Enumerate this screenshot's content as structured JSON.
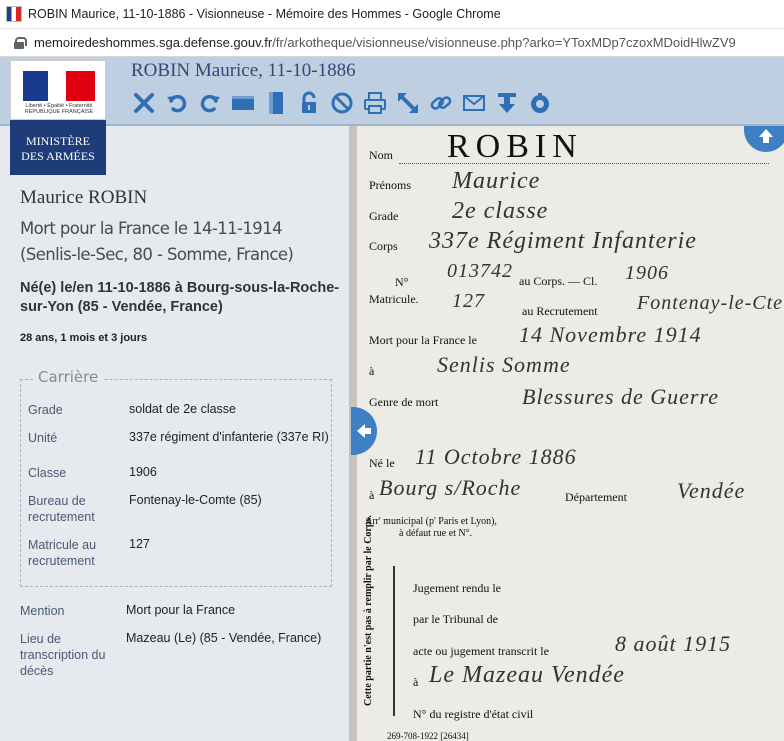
{
  "browser": {
    "window_title": "ROBIN Maurice, 11-10-1886 - Visionneuse - Mémoire des Hommes - Google Chrome",
    "url_host": "memoiredeshommes.sga.defense.gouv.fr",
    "url_path": "/fr/arkotheque/visionneuse/visionneuse.php?arko=YToxMDp7czoxMDoidHlwZV9"
  },
  "header": {
    "doc_title": "ROBIN Maurice, 11-10-1886",
    "ministry_line1": "MINISTÈRE",
    "ministry_line2": "DES ARMÉES",
    "logo_text": "Liberté • Égalité • Fraternité RÉPUBLIQUE FRANÇAISE",
    "accent": "#2f6fb3",
    "toolbar_icons": [
      "close-icon",
      "undo-icon",
      "redo-icon",
      "horizontal-fit-icon",
      "vertical-fit-icon",
      "lock-icon",
      "no-entry-icon",
      "print-icon",
      "expand-icon",
      "link-icon",
      "mail-icon",
      "download-icon",
      "lifebuoy-icon"
    ]
  },
  "record": {
    "name": "Maurice ROBIN",
    "death": "Mort pour la France le 14-11-1914 (Senlis-le-Sec, 80 - Somme, France)",
    "birth": "Né(e) le/en 11-10-1886 à Bourg-sous-la-Roche-sur-Yon (85 - Vendée, France)",
    "age": "28 ans, 1 mois et 3 jours",
    "career_legend": "Carrière",
    "career": [
      {
        "label": "Grade",
        "value": "soldat de 2e classe"
      },
      {
        "label": "Unité",
        "value": "337e régiment d'infanterie (337e RI)"
      },
      {
        "label": "Classe",
        "value": "1906"
      },
      {
        "label": "Bureau de recrutement",
        "value": "Fontenay-le-Comte (85)"
      },
      {
        "label": "Matricule au recrutement",
        "value": "127"
      }
    ],
    "mention_label": "Mention",
    "mention_value": "Mort pour la France",
    "lieu_label": "Lieu de transcription du décès",
    "lieu_value": "Mazeau (Le) (85 - Vendée, France)"
  },
  "document": {
    "nom_label": "Nom",
    "nom_value": "ROBIN",
    "prenoms_label": "Prénoms",
    "prenoms_value": "Maurice",
    "grade_label": "Grade",
    "grade_value": "2e classe",
    "corps_label": "Corps",
    "corps_value": "337e Régiment Infanterie",
    "no_label": "N°",
    "matricule_label": "Matricule.",
    "corps_no_value": "013742",
    "au_corps_label": "au Corps. — Cl.",
    "classe_value": "1906",
    "recrut_no_value": "127",
    "au_recrut_label": "au Recrutement",
    "recrut_value": "Fontenay-le-Cte",
    "mort_label": "Mort pour la France le",
    "mort_value": "14 Novembre 1914",
    "a_label": "à",
    "lieu_mort_value": "Senlis   Somme",
    "genre_label": "Genre de mort",
    "genre_value": "Blessures de Guerre",
    "ne_label": "Né le",
    "ne_value": "11 Octobre 1886",
    "a2_label": "à",
    "lieu_naiss_value": "Bourg s/Roche",
    "departement_label": "Département",
    "departement_value": "Vendée",
    "arr_label": "Arr' municipal (p' Paris et Lyon),",
    "defaut_label": "à défaut rue et N°.",
    "side_label": "Cette partie n'est pas à remplir par le Corps.",
    "jugement_label": "Jugement rendu le",
    "tribunal_label": "par le Tribunal de",
    "acte_label": "acte ou jugement transcrit le",
    "acte_value": "8 août 1915",
    "a3_label": "à",
    "lieu_acte_value": "Le Mazeau   Vendée",
    "registre_label": "N° du registre d'état civil",
    "footer_code": "269-708-1922   [26434]"
  }
}
